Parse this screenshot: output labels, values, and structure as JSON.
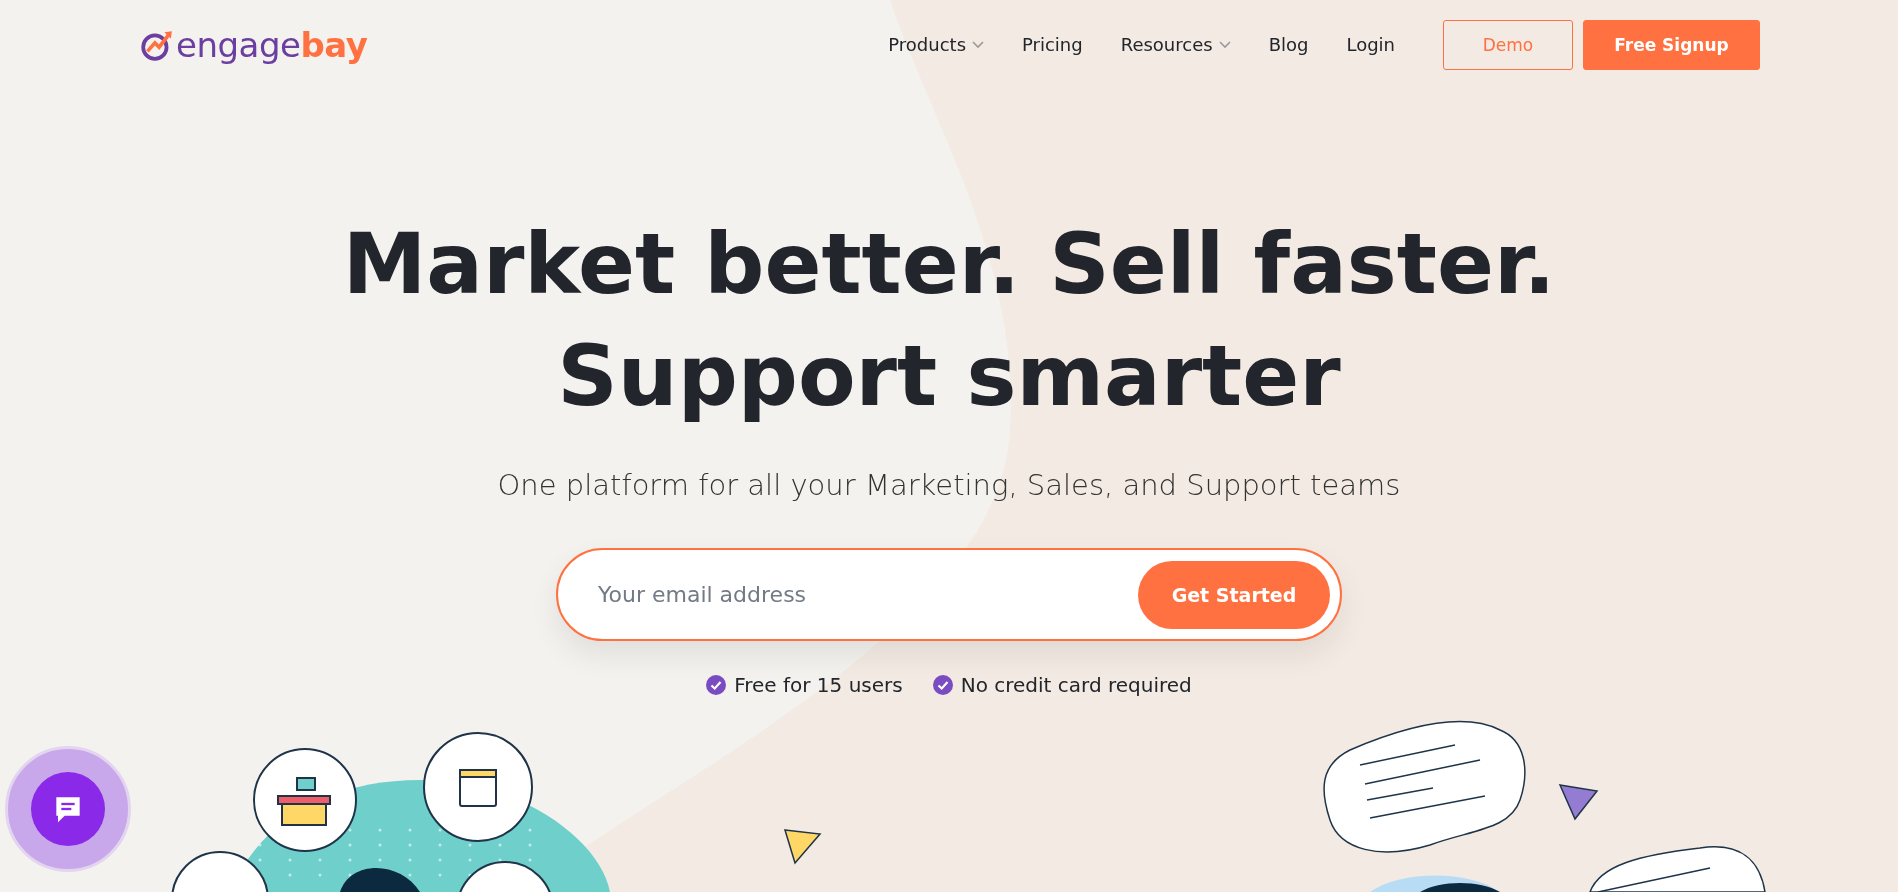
{
  "logo": {
    "part_1": "engage",
    "part_2": "bay"
  },
  "nav": [
    {
      "label": "Products",
      "dropdown": true
    },
    {
      "label": "Pricing",
      "dropdown": false
    },
    {
      "label": "Resources",
      "dropdown": true
    },
    {
      "label": "Blog",
      "dropdown": false
    },
    {
      "label": "Login",
      "dropdown": false
    }
  ],
  "header_buttons": [
    {
      "label": "Demo",
      "kind": "outline"
    },
    {
      "label": "Free Signup",
      "kind": "filled"
    }
  ],
  "hero": {
    "title_lines": [
      "Market better. Sell faster.",
      "Support smarter"
    ],
    "subtitle": "One platform for all your Marketing, Sales, and Support teams"
  },
  "signup": {
    "placeholder": "Your email address",
    "button": "Get Started"
  },
  "perks": [
    "Free for 15 users",
    "No credit card required"
  ]
}
